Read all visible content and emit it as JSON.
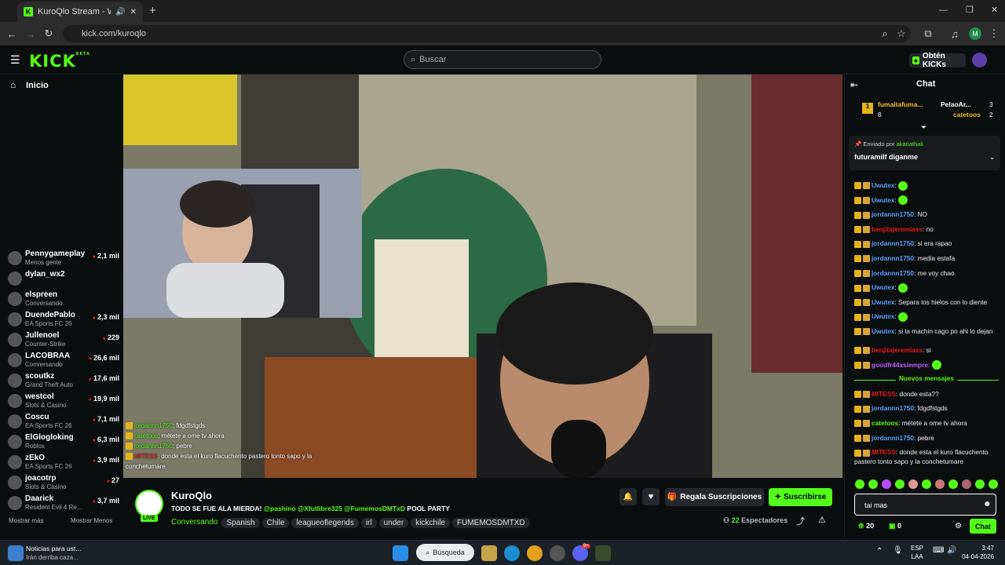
{
  "browser": {
    "tab_title": "KuroQlo Stream - Watch Li",
    "url": "kick.com/kuroqlo",
    "profile_initial": "M",
    "new_tab": "+",
    "close": "✕"
  },
  "header": {
    "logo": "KICK",
    "logo_beta": "BETA",
    "search_placeholder": "Buscar",
    "get_kicks": "Obtén KICKs"
  },
  "sidebar": {
    "home_label": "Inicio",
    "channels": [
      {
        "name": "Pennygameplay",
        "category": "Menos gente",
        "viewers": "2,1 mil"
      },
      {
        "name": "dylan_wx2",
        "category": "",
        "viewers": ""
      },
      {
        "name": "elspreen",
        "category": "Conversando",
        "viewers": ""
      },
      {
        "name": "DuendePablo",
        "category": "EA Sports FC 26",
        "viewers": "2,3 mil"
      },
      {
        "name": "Jullenoel",
        "category": "Counter-Strike",
        "viewers": "229"
      },
      {
        "name": "LACOBRAA",
        "category": "Conversando",
        "viewers": "26,6 mil"
      },
      {
        "name": "scoutkz",
        "category": "Grand Theft Auto",
        "viewers": "17,6 mil"
      },
      {
        "name": "westcol",
        "category": "Slots & Casino",
        "viewers": "19,9 mil"
      },
      {
        "name": "Coscu",
        "category": "EA Sports FC 26",
        "viewers": "7,1 mil"
      },
      {
        "name": "ElGlogloking",
        "category": "Roblox",
        "viewers": "6,3 mil"
      },
      {
        "name": "zEkO",
        "category": "EA Sports FC 26",
        "viewers": "3,9 mil"
      },
      {
        "name": "joacotrp",
        "category": "Slots & Casino",
        "viewers": "27"
      },
      {
        "name": "Daarick",
        "category": "Resident Evil 4 Re...",
        "viewers": "3,7 mil"
      }
    ],
    "show_more": "Mostrar más",
    "show_less": "Mostrar Menos"
  },
  "overlay_chat": [
    {
      "user": "jordannn1750",
      "text": ": fdgdfstgds",
      "color": "#53fc18"
    },
    {
      "user": "catetoos",
      "text": ": métete a ome tv ahora",
      "color": "#53fc18"
    },
    {
      "user": "jordannn1750",
      "text": ": pebre",
      "color": "#53fc18"
    },
    {
      "user": "MITESS",
      "text": ": donde esta el kuro flacuchento pastero tonto sapo y la conchetumare",
      "color": "#e91916"
    }
  ],
  "stream": {
    "streamer": "KuroQlo",
    "live_label": "LIVE",
    "title": "TODO SE FUE ALA MIERDA!",
    "title_mentions": "@pashino @Xfutlibre325 @FumemosDMTxD",
    "title_tail": "POOL PARTY",
    "category": "Conversando",
    "tags": [
      "Spanish",
      "Chile",
      "leagueoflegends",
      "irl",
      "under",
      "kickchile",
      "FUMEMOSDMTXD"
    ],
    "gift_subs": "Regala Suscripciones",
    "subscribe": "Suscribirse",
    "viewers": "22",
    "viewers_label": "Espectadores"
  },
  "chat": {
    "title": "Chat",
    "leaderboard": [
      {
        "rank": "1",
        "user": "fumaitafuma...",
        "count": "8"
      },
      {
        "user": "PelaoAr...",
        "count": "3"
      },
      {
        "user": "catetoos",
        "count": "2"
      }
    ],
    "pinned_by_label": "Enviado por",
    "pinned_by": "akanathali",
    "pinned_text": "futuramilf diganme",
    "messages": [
      {
        "user": "Uwutex",
        "text": ":",
        "color": "#5ba0ff",
        "emote": true
      },
      {
        "user": "Uwutex",
        "text": ":",
        "color": "#5ba0ff",
        "emote": true
      },
      {
        "user": "jordannn1750",
        "text": ": NO",
        "color": "#5ba0ff"
      },
      {
        "user": "benjitajeremiass",
        "text": ": no",
        "color": "#e91916"
      },
      {
        "user": "jordannn1750",
        "text": ": si era rapao",
        "color": "#5ba0ff"
      },
      {
        "user": "jordannn1750",
        "text": ": media estafa",
        "color": "#5ba0ff"
      },
      {
        "user": "jordannn1750",
        "text": ": me voy chao",
        "color": "#5ba0ff"
      },
      {
        "user": "Uwutex",
        "text": ":",
        "color": "#5ba0ff",
        "emote": true
      },
      {
        "user": "Uwutex",
        "text": ": Separa los hielos con lo diente",
        "color": "#5ba0ff"
      },
      {
        "user": "Uwutex",
        "text": ":",
        "color": "#5ba0ff",
        "emote": true
      },
      {
        "user": "Uwutex",
        "text": ": si la machin cago po ahi lo dejan",
        "color": "#5ba0ff"
      },
      {
        "user": "benjitajeremiass",
        "text": ": si",
        "color": "#e91916"
      },
      {
        "user": "goodfr44xsiempre",
        "text": ":",
        "color": "#c15bff",
        "emote": true
      }
    ],
    "new_messages_label": "Nuevos mensajes",
    "new_messages": [
      {
        "user": "MITESS",
        "text": ": donde esta??",
        "color": "#e91916"
      },
      {
        "user": "jordannn1750",
        "text": ": fdgdfstgds",
        "color": "#5ba0ff"
      },
      {
        "user": "catetoos",
        "text": ": métete a ome tv ahora",
        "color": "#53fc18"
      },
      {
        "user": "jordannn1750",
        "text": ": pebre",
        "color": "#5ba0ff"
      },
      {
        "user": "MITESS",
        "text": ": donde esta el kuro flacuchento pastero tonto sapo y la conchetumare",
        "color": "#e91916"
      }
    ],
    "input_value": "tai mas",
    "points": "20",
    "kicks": "0",
    "send_label": "Chat"
  },
  "taskbar": {
    "news_title": "Noticias para ust...",
    "news_sub": "Irán derriba caza...",
    "search_label": "Búsqueda",
    "lang": "ESP",
    "lang_sub": "LAA",
    "time": "3:47",
    "date": "04-04-2026",
    "discord_badge": "9+"
  },
  "colors": {
    "accent": "#53fc18",
    "bg": "#0b0e0f"
  }
}
